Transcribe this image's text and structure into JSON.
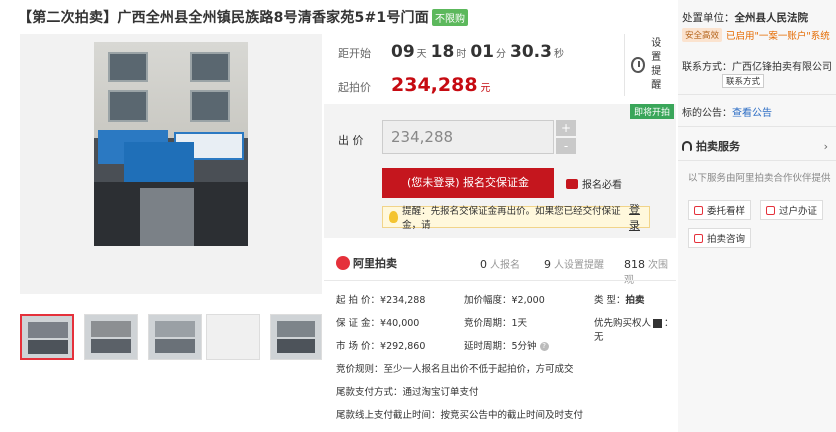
{
  "title": {
    "text": "【第二次拍卖】广西全州县全州镇民族路8号清香家苑5#1号门面",
    "tag": "不限购"
  },
  "countdown": {
    "label": "距开始",
    "days": "09",
    "days_unit": "天",
    "hours": "18",
    "hours_unit": "时",
    "minutes": "01",
    "minutes_unit": "分",
    "seconds": "30.3",
    "seconds_unit": "秒",
    "remind_label": "设置提醒"
  },
  "start_price": {
    "label": "起拍价",
    "value": "234,288",
    "unit": "元"
  },
  "bid": {
    "badge": "即将开拍",
    "label": "出  价",
    "input_value": "234,288",
    "plus": "+",
    "minus": "-",
    "signup_button": "(您未登录) 报名交保证金",
    "must_read": "报名必看",
    "tip_text": "提醒：先报名交保证金再出价。如果您已经交付保证金，请",
    "tip_link": "登录"
  },
  "stats": {
    "logo": "阿里拍卖",
    "signup_count": "0",
    "signup_label": "人报名",
    "remind_count": "9",
    "remind_label": "人设置提醒",
    "view_count": "818",
    "view_label": "次围观"
  },
  "details": {
    "start_price": "起 拍 价：¥234,288",
    "increment": "加价幅度：¥2,000",
    "type_label": "类    型：",
    "type_value": "拍卖",
    "deposit": "保 证 金：¥40,000",
    "bid_period": "竞价周期：1天",
    "priority": "优先购买权人",
    "priority_suffix": "：无",
    "market_price": "市 场 价：¥292,860",
    "delay_period": "延时周期：5分钟",
    "help": "?",
    "rule": "竞价规则：至少一人报名且出价不低于起拍价，方可成交",
    "payment": "尾款支付方式：通过淘宝订单支付",
    "deadline": "尾款线上支付截止时间：按竞买公告中的截止时间及时支付"
  },
  "right_panel": {
    "court_label": "处置单位：",
    "court_name": "全州县人民法院",
    "badge": "安全高效",
    "system_link": "已启用\"一案一账户\"系统",
    "contact": "联系方式：广西亿锋拍卖有限公司",
    "contact_button": "联系方式",
    "notice_label": "标的公告：",
    "notice_link": "查看公告",
    "service_title": "拍卖服务",
    "service_desc": "以下服务由阿里拍卖合作伙伴提供",
    "btn_inspect": "委托看样",
    "btn_transfer": "过户办证",
    "btn_consult": "拍卖咨询"
  }
}
